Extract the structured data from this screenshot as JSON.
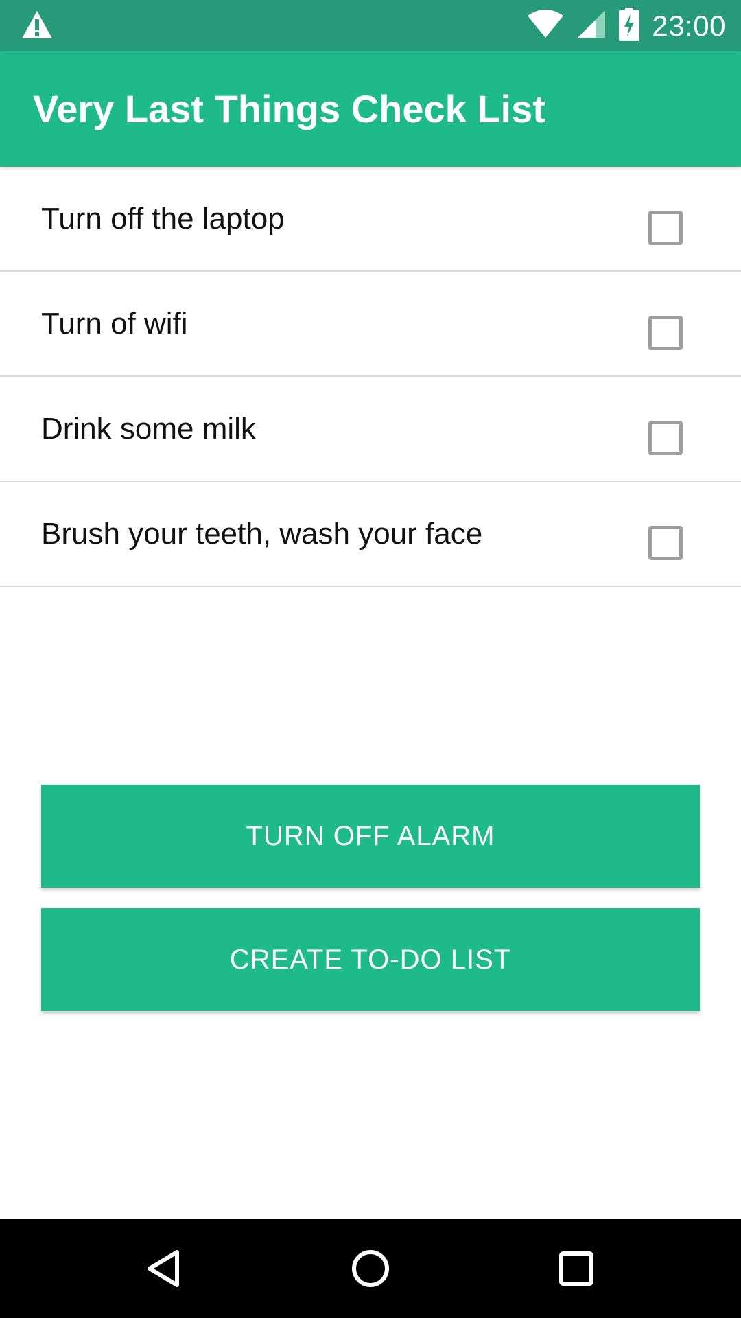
{
  "status_bar": {
    "warning_icon": "warning-icon",
    "wifi_icon": "wifi-icon",
    "signal_icon": "cell-signal-icon",
    "battery_icon": "battery-charging-icon",
    "time": "23:00",
    "background_color": "#279a7a"
  },
  "app_bar": {
    "title": "Very Last Things Check List",
    "background_color": "#1fba89"
  },
  "checklist": {
    "items": [
      {
        "label": "Turn off the laptop",
        "checked": false
      },
      {
        "label": "Turn of wifi",
        "checked": false
      },
      {
        "label": "Drink some milk",
        "checked": false
      },
      {
        "label": "Brush your teeth, wash your face",
        "checked": false
      }
    ]
  },
  "buttons": {
    "turn_off_alarm": "TURN OFF ALARM",
    "create_todo_list": "CREATE TO-DO LIST",
    "accent_color": "#1fba89"
  },
  "nav_bar": {
    "back_icon": "back-triangle-icon",
    "home_icon": "home-circle-icon",
    "recents_icon": "recents-square-icon"
  }
}
